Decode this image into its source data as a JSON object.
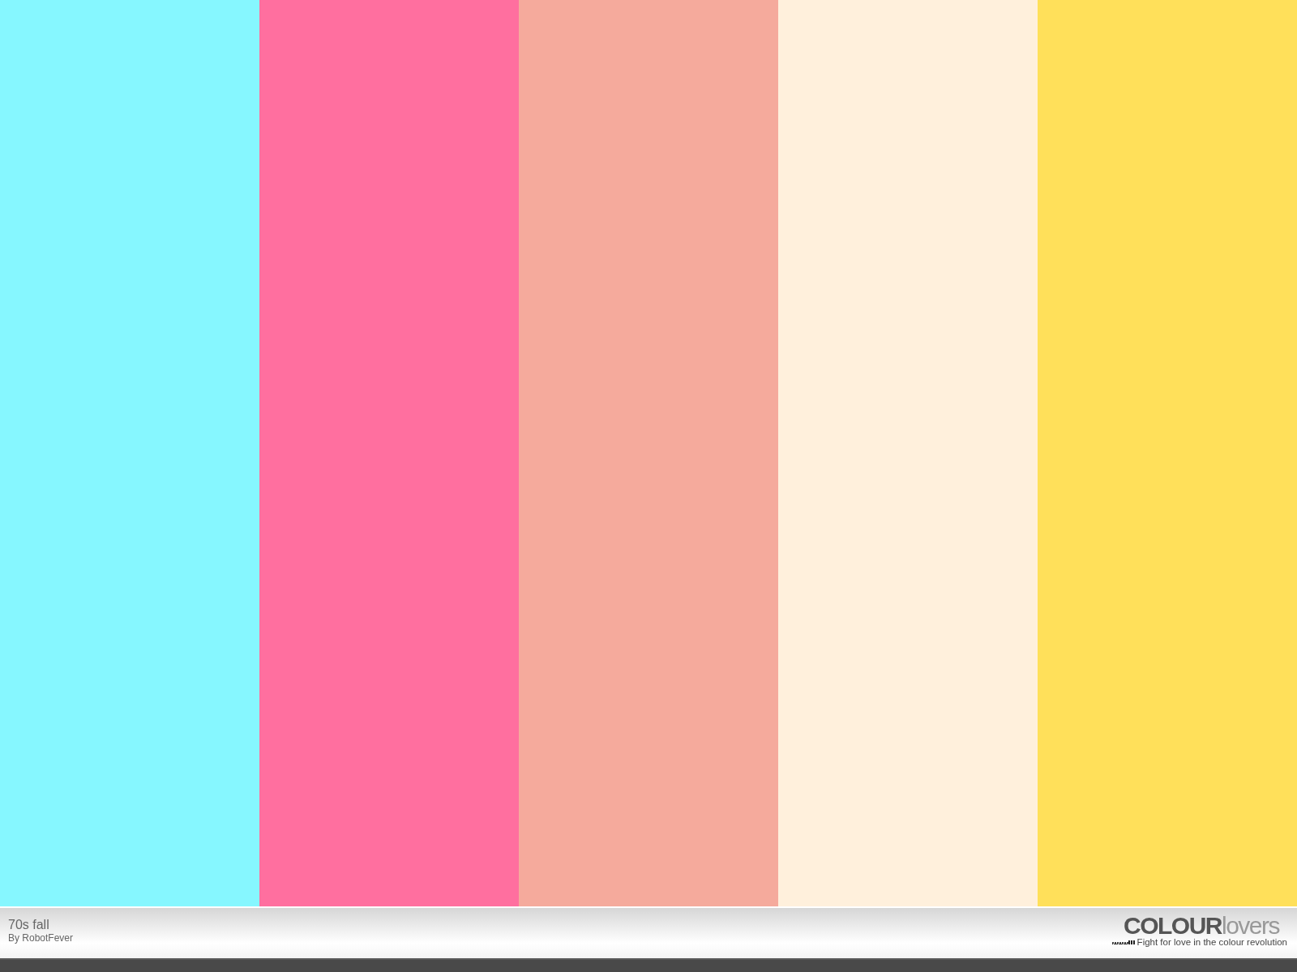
{
  "palette": {
    "swatches": [
      {
        "color": "#86f7ff"
      },
      {
        "color": "#ff6f9f"
      },
      {
        "color": "#f5aa9c"
      },
      {
        "color": "#fff0dc"
      },
      {
        "color": "#ffe05a"
      }
    ]
  },
  "footer": {
    "title": "70s fall",
    "author": "By RobotFever",
    "logo": {
      "primary": "COLOUR",
      "secondary": "lovers"
    },
    "tagline": "Fight for love in the colour revolution"
  }
}
